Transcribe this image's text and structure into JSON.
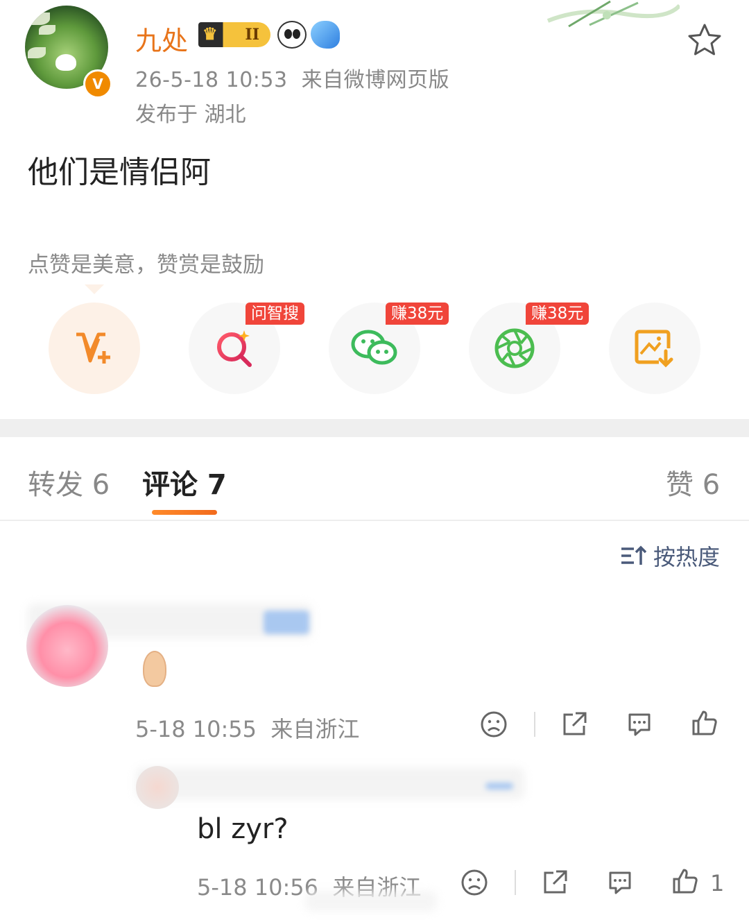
{
  "post": {
    "username": "九处",
    "level_badge": "II",
    "time": "26-5-18 10:53",
    "source": "来自微博网页版",
    "location": "发布于 湖北",
    "content": "他们是情侣阿",
    "reward_prompt": "点赞是美意，赞赏是鼓励"
  },
  "actions": [
    {
      "icon": "v-plus-icon",
      "tag": ""
    },
    {
      "icon": "ai-search-icon",
      "tag": "问智搜"
    },
    {
      "icon": "wechat-icon",
      "tag": "赚38元"
    },
    {
      "icon": "moments-icon",
      "tag": "赚38元"
    },
    {
      "icon": "save-image-icon",
      "tag": ""
    }
  ],
  "tabs": {
    "repost": "转发 6",
    "comment": "评论 7",
    "like": "赞 6"
  },
  "sort_label": "按热度",
  "comments": [
    {
      "content_icon": "ear-emoji",
      "time": "5-18 10:55",
      "source": "来自浙江",
      "likes": ""
    },
    {
      "text": "bl zyr?",
      "time": "5-18 10:56",
      "source": "来自浙江",
      "likes": "1"
    }
  ],
  "colors": {
    "accent": "#e8741a",
    "tag_red": "#f0453a",
    "wechat_green": "#3dbb5c"
  }
}
